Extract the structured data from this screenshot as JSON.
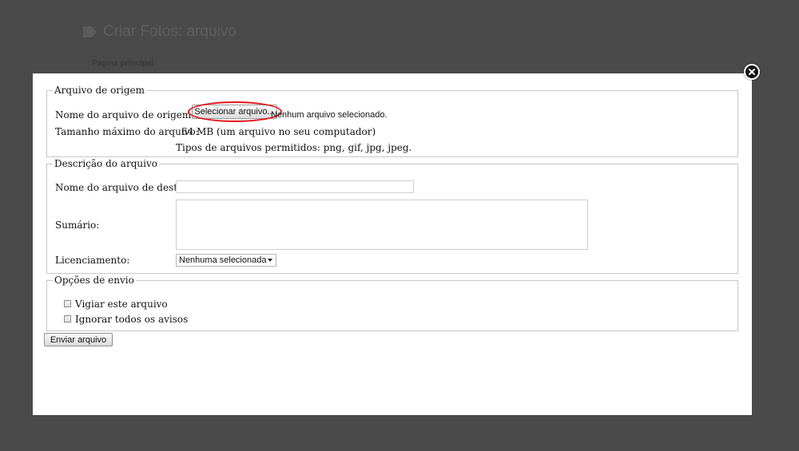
{
  "background_page": {
    "title": "Criar Fotos: arquivo",
    "breadcrumb": "Página principal"
  },
  "modal": {
    "source_section": {
      "legend": "Arquivo de origem",
      "source_file_label": "Nome do arquivo de origem:",
      "choose_button_label": "Selecionar arquivo...",
      "file_status": "Nenhum arquivo selecionado.",
      "max_size_label": "Tamanho máximo do arquivo:",
      "max_size_value": "64 MB (um arquivo no seu computador)",
      "allowed_types": "Tipos de arquivos permitidos: png, gif, jpg, jpeg."
    },
    "description_section": {
      "legend": "Descrição do arquivo",
      "dest_name_label": "Nome do arquivo de destino:",
      "dest_name_value": "",
      "summary_label": "Sumário:",
      "summary_value": "",
      "licensing_label": "Licenciamento:",
      "licensing_selected": "Nenhuma selecionada"
    },
    "options_section": {
      "legend": "Opções de envio",
      "watch_label": "Vigiar este arquivo",
      "watch_checked": false,
      "ignore_warnings_label": "Ignorar todos os avisos",
      "ignore_warnings_checked": false
    },
    "submit_label": "Enviar arquivo",
    "highlight_color": "#e3161d"
  },
  "icons": {
    "title_icon": "tag-icon",
    "close_icon": "close-icon"
  }
}
